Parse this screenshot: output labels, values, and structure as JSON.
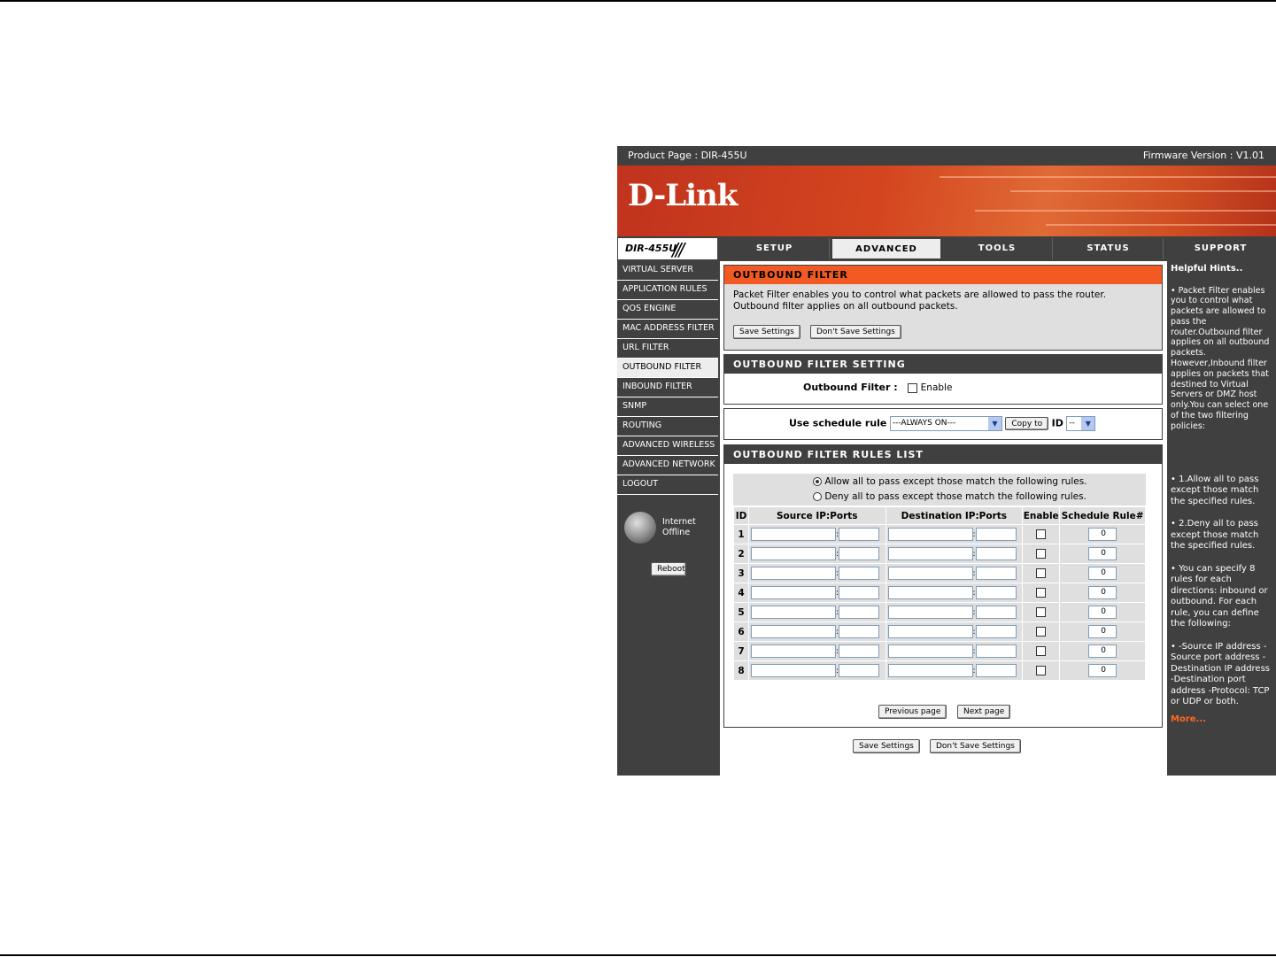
{
  "header": {
    "product_page": "Product Page :  DIR-455U",
    "firmware": "Firmware Version : V1.01",
    "logo": "D-Link",
    "model": "DIR-455U"
  },
  "tabs": [
    "SETUP",
    "ADVANCED",
    "TOOLS",
    "STATUS",
    "SUPPORT"
  ],
  "active_tab": "ADVANCED",
  "left_nav": [
    "VIRTUAL SERVER",
    "APPLICATION RULES",
    "QOS ENGINE",
    "MAC ADDRESS FILTER",
    "URL FILTER",
    "OUTBOUND FILTER",
    "INBOUND FILTER",
    "SNMP",
    "ROUTING",
    "ADVANCED WIRELESS",
    "ADVANCED NETWORK",
    "LOGOUT"
  ],
  "active_nav": "OUTBOUND FILTER",
  "status": {
    "line1": "Internet",
    "line2": "Offline",
    "reboot": "Reboot"
  },
  "intro": {
    "title": "OUTBOUND FILTER",
    "description": "Packet Filter enables you to control what packets are allowed to pass the router. Outbound filter applies on all outbound packets.",
    "save": "Save Settings",
    "dont_save": "Don't Save Settings"
  },
  "setting": {
    "title": "OUTBOUND FILTER SETTING",
    "label": "Outbound Filter :",
    "enable": "Enable"
  },
  "schedule": {
    "label": "Use schedule rule",
    "selected": "---ALWAYS ON---",
    "copy_to": "Copy to",
    "id_label": "ID",
    "id_selected": "--"
  },
  "rules_list": {
    "title": "OUTBOUND FILTER RULES LIST",
    "allow_text": "Allow all to pass except those match the following rules.",
    "deny_text": "Deny all to pass except those match the following rules.",
    "columns": [
      "ID",
      "Source IP:Ports",
      "Destination IP:Ports",
      "Enable",
      "Schedule Rule#"
    ],
    "rows": [
      {
        "id": "1",
        "schedule": "0"
      },
      {
        "id": "2",
        "schedule": "0"
      },
      {
        "id": "3",
        "schedule": "0"
      },
      {
        "id": "4",
        "schedule": "0"
      },
      {
        "id": "5",
        "schedule": "0"
      },
      {
        "id": "6",
        "schedule": "0"
      },
      {
        "id": "7",
        "schedule": "0"
      },
      {
        "id": "8",
        "schedule": "0"
      }
    ],
    "prev_page": "Previous page",
    "next_page": "Next page"
  },
  "footer": {
    "save": "Save Settings",
    "dont_save": "Don't Save Settings"
  },
  "hints": {
    "title": "Helpful Hints..",
    "p1": "•  Packet Filter enables you to control what packets are allowed to pass the router.Outbound filter applies on all outbound packets. However,Inbound filter applies on packets that destined to Virtual Servers or DMZ host only.You can select one of the two filtering policies:",
    "p2": "•  1.Allow all to pass except those match the specified rules.",
    "p3": "•  2.Deny all to pass except those match the specified rules.",
    "p4": "•  You can specify 8 rules for each directions: inbound or outbound. For each rule, you can define the following:",
    "p5": "•  -Source IP address -Source port address -Destination IP address -Destination port address -Protocol: TCP or UDP or both.",
    "more": "More..."
  },
  "colors": {
    "accent": "#f15a22",
    "dark": "#404040",
    "panel": "#dfdfdf"
  }
}
